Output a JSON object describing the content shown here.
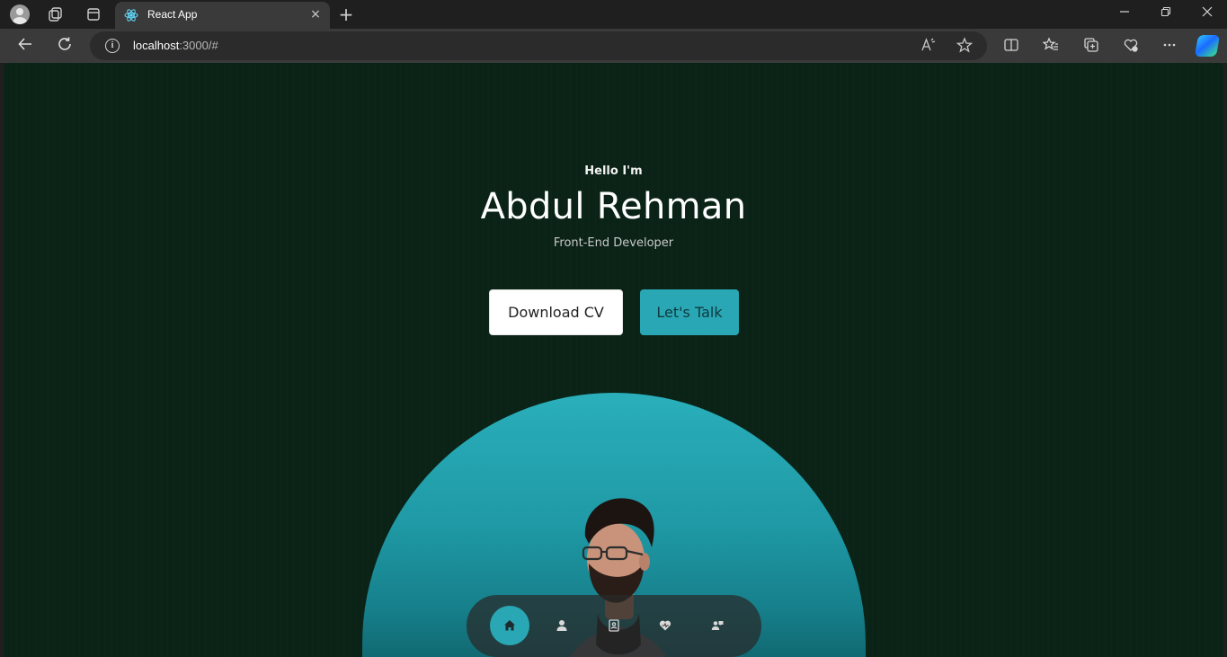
{
  "browser": {
    "tab_title": "React App",
    "url_host": "localhost",
    "url_rest": ":3000/#",
    "new_tab_symbol": "+",
    "close_tab_symbol": "×"
  },
  "hero": {
    "greeting": "Hello I'm",
    "name": "Abdul Rehman",
    "role": "Front-End Developer",
    "download_cv_label": "Download CV",
    "lets_talk_label": "Let's Talk"
  },
  "nav": {
    "items": [
      {
        "icon": "home-icon",
        "active": true
      },
      {
        "icon": "user-icon",
        "active": false
      },
      {
        "icon": "book-icon",
        "active": false
      },
      {
        "icon": "services-icon",
        "active": false
      },
      {
        "icon": "contact-icon",
        "active": false
      }
    ]
  },
  "colors": {
    "page_bg": "#0a2316",
    "accent": "#2aa7b4",
    "browser_bar": "#3a3a3a"
  }
}
